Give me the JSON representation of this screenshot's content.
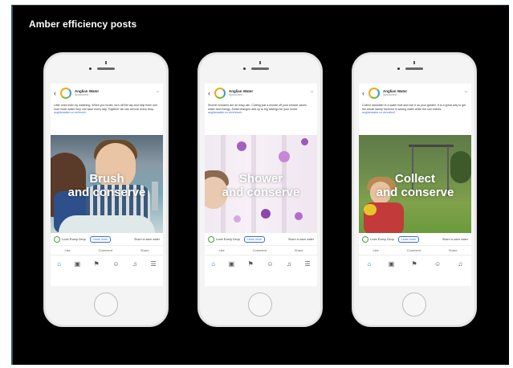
{
  "slide": {
    "title": "Amber efficiency posts"
  },
  "phones": [
    {
      "page_name": "Anglian Water",
      "page_sub": "Sponsored · ◌",
      "post_text": "Little ones learn by watching. When you brush, turn off the tap and help them see how much water they can save every day. Together we can all love every drop.",
      "link_text": "anglianwater.co.uk/brush",
      "headline_1": "Brush",
      "headline_2": "and conserve",
      "engage_label": "Love Every Drop",
      "pill_label": "Learn more",
      "cta_text": "Share to save water",
      "actions": [
        "Like",
        "Comment",
        "Share"
      ]
    },
    {
      "page_name": "Anglian Water",
      "page_sub": "Sponsored · ◌",
      "post_text": "Shorter showers are an easy win. Cutting just a minute off your shower saves water and energy. Small changes add up to big savings for your home.",
      "link_text": "anglianwater.co.uk/shower",
      "headline_1": "Shower",
      "headline_2": "and conserve",
      "engage_label": "Love Every Drop",
      "pill_label": "Learn more",
      "cta_text": "Share to save water",
      "actions": [
        "Like",
        "Comment",
        "Share"
      ]
    },
    {
      "page_name": "Anglian Water",
      "page_sub": "Sponsored · ◌",
      "post_text": "Collect rainwater in a water butt and use it on your garden. It is a great way to get the whole family involved in saving water while the sun shines.",
      "link_text": "anglianwater.co.uk/collect",
      "headline_1": "Collect",
      "headline_2": "and conserve",
      "engage_label": "Love Every Drop",
      "pill_label": "Learn more",
      "cta_text": "Share to save water",
      "actions": [
        "Like",
        "Comment",
        "Share"
      ]
    }
  ],
  "icons": {
    "back": "‹",
    "more": "···",
    "home": "⌂",
    "tabs": [
      "⌂",
      "▣",
      "⚑",
      "☺",
      "♫",
      "☰"
    ]
  },
  "colors": {
    "background": "#000000",
    "accent": "#1877f2",
    "brand_orange": "#f0a81c",
    "brand_green": "#7cbd3b"
  }
}
